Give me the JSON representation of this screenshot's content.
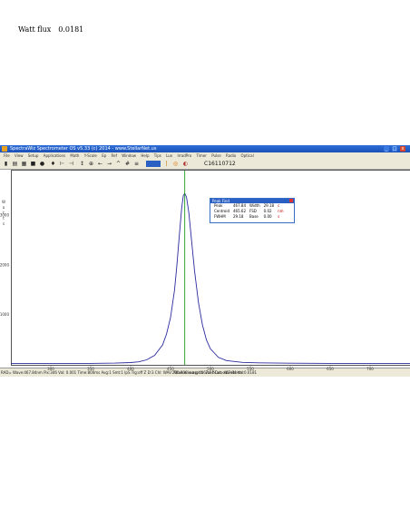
{
  "window": {
    "title": "SpectraWiz Spectrometer OS v5.33 (c) 2014 - www.StellarNet.us",
    "minimize": "_",
    "maximize": "□",
    "close": "x"
  },
  "menu": [
    "File",
    "View",
    "Setup",
    "Applications",
    "Math",
    "Y-Scale",
    "Ep",
    "Ref",
    "Window",
    "Help",
    "Tips",
    "Lux",
    "IrradPro",
    "Timer",
    "Pulse",
    "Radio",
    "Optical"
  ],
  "toolbar": {
    "icons": [
      "open-icon",
      "save-icon",
      "print-icon",
      "stop-icon",
      "lamp-icon",
      "pin-icon",
      "cursor-left-icon",
      "cursor-right-icon",
      "scale-icon",
      "zoom-icon",
      "arrow-left-icon",
      "arrow-right-icon",
      "peak-icon",
      "grid-icon",
      "overlay-icon",
      "color-icon",
      "bar-icon",
      "target-icon",
      "capture-icon"
    ],
    "code": "C16110712"
  },
  "readout": {
    "label": "Watt flux",
    "value": "0.0181"
  },
  "peak_find": {
    "title": "Peak Find",
    "rows": [
      [
        "Peak",
        "467.84",
        "Width",
        "29.18",
        "c"
      ],
      [
        "Centroid",
        "465.62",
        "FSD",
        "0.02",
        "nm"
      ],
      [
        "FWHM",
        "29.18",
        "Base",
        "0.00",
        "s"
      ]
    ]
  },
  "status": "RAD= Wave:467.84nm Pix:346 Val: 0.001 Time:800ms Avg:1 Smt:1 IpS Trg:off Z D:3 Chl: WAV:200-800 cursor:467.84 Cnt: 467.84 Val:0.0181",
  "chart_data": {
    "type": "line",
    "xlabel": "Wavelength in Nanometers",
    "ylabel": "Watts",
    "x_ticks": [
      300,
      350,
      400,
      450,
      500,
      550,
      600,
      650,
      700
    ],
    "x_range": [
      250,
      750
    ],
    "y_ticks": [
      1000,
      2000,
      3000
    ],
    "y_range": [
      0,
      3900
    ],
    "cursor_x": 467.84,
    "line_color": "#2b2b9e",
    "cursor_color": "#009000",
    "grid": false,
    "series": [
      {
        "points": [
          [
            250,
            30
          ],
          [
            300,
            30
          ],
          [
            350,
            30
          ],
          [
            380,
            35
          ],
          [
            400,
            45
          ],
          [
            410,
            60
          ],
          [
            420,
            100
          ],
          [
            430,
            190
          ],
          [
            440,
            400
          ],
          [
            445,
            620
          ],
          [
            450,
            950
          ],
          [
            455,
            1500
          ],
          [
            458,
            2000
          ],
          [
            461,
            2600
          ],
          [
            464,
            3150
          ],
          [
            466,
            3400
          ],
          [
            467.84,
            3440
          ],
          [
            470,
            3370
          ],
          [
            473,
            3050
          ],
          [
            476,
            2550
          ],
          [
            480,
            1900
          ],
          [
            485,
            1250
          ],
          [
            490,
            800
          ],
          [
            495,
            500
          ],
          [
            500,
            320
          ],
          [
            510,
            150
          ],
          [
            520,
            85
          ],
          [
            540,
            50
          ],
          [
            560,
            40
          ],
          [
            600,
            32
          ],
          [
            650,
            30
          ],
          [
            700,
            30
          ],
          [
            750,
            30
          ]
        ]
      }
    ]
  }
}
